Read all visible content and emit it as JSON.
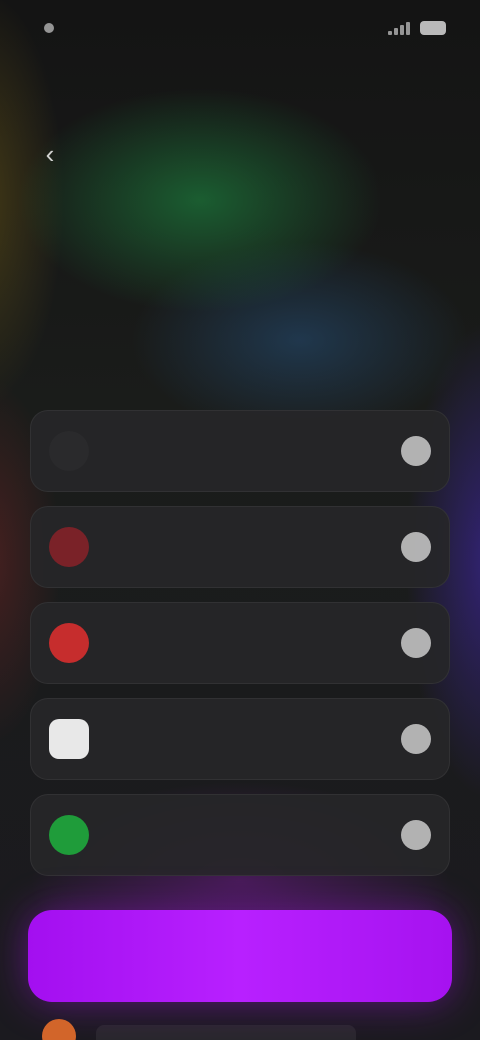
{
  "status_bar": {
    "time": "",
    "battery_label": ""
  },
  "header": {
    "back_icon": "chevron-left-icon",
    "title": "",
    "subtitle": ""
  },
  "options": [
    {
      "label": "",
      "sublabel": "",
      "icon": "dark-circle-icon",
      "color": "#2a2a2c",
      "selected": false
    },
    {
      "label": "",
      "sublabel": "",
      "icon": "red-circle-icon",
      "color": "#7a2228",
      "selected": false
    },
    {
      "label": "",
      "sublabel": "",
      "icon": "red-circle-icon",
      "color": "#c62d2d",
      "selected": false
    },
    {
      "label": "",
      "sublabel": "",
      "icon": "white-square-icon",
      "color": "#e8e8e8",
      "selected": false
    },
    {
      "label": "",
      "sublabel": "",
      "icon": "green-circle-icon",
      "color": "#1f9c3a",
      "selected": false
    }
  ],
  "cta": {
    "label": "",
    "color": "#b01cff"
  }
}
